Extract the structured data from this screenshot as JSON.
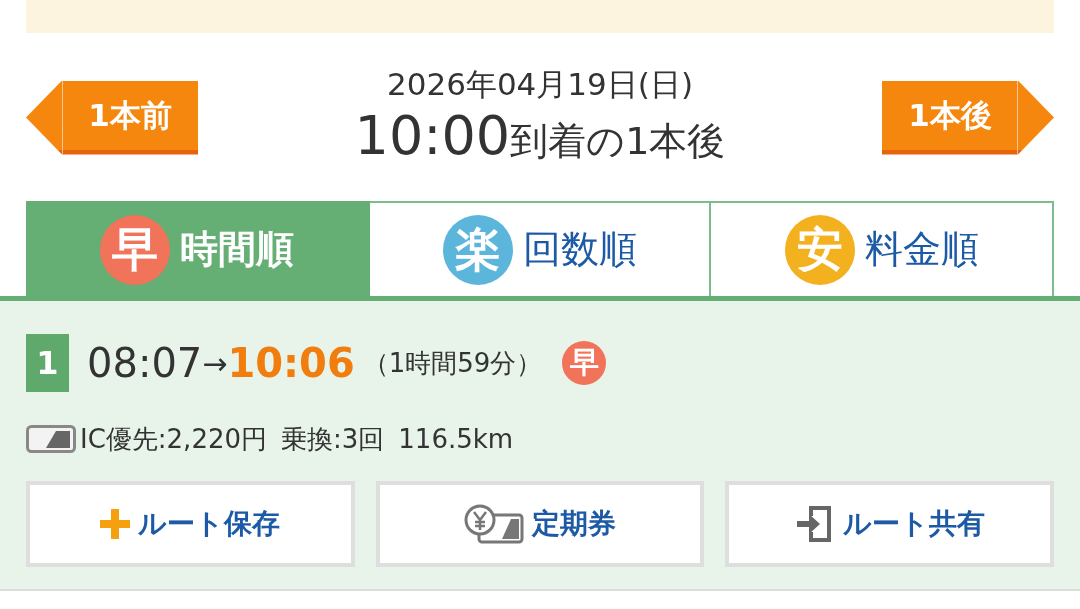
{
  "navigation": {
    "previous_button": "1本前",
    "date": "2026年04月19日(日)",
    "time": "10:00",
    "condition": "到着の1本後",
    "next_button": "1本後"
  },
  "sort_tabs": [
    {
      "badge": "早",
      "color": "#f0735a",
      "label": "時間順",
      "selected": true
    },
    {
      "badge": "楽",
      "color": "#5cb6dc",
      "label": "回数順",
      "selected": false
    },
    {
      "badge": "安",
      "color": "#f4b11f",
      "label": "料金順",
      "selected": false
    }
  ],
  "route": {
    "number": "1",
    "departure": "08:07",
    "arrow": "→",
    "arrival": "10:06",
    "duration": "（1時間59分）",
    "badge": "早",
    "fare": "IC優先:2,220円",
    "transfers": "乗換:3回",
    "distance": "116.5km"
  },
  "actions": [
    {
      "kind": "save",
      "label": "ルート保存"
    },
    {
      "kind": "pass",
      "label": "定期券"
    },
    {
      "kind": "share",
      "label": "ルート共有"
    }
  ]
}
